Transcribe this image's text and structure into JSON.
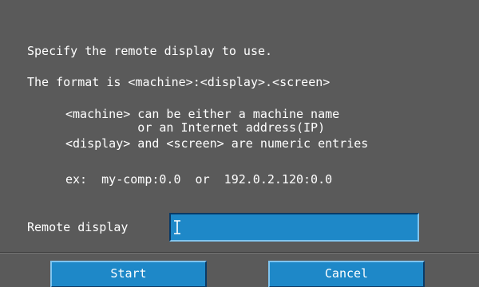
{
  "dialog": {
    "lines": {
      "intro": "Specify the remote display to use.",
      "format": "The format is <machine>:<display>.<screen>",
      "machine_1": "<machine> can be either a machine name",
      "machine_2": "          or an Internet address(IP)",
      "display": "<display> and <screen> are numeric entries",
      "example": "ex:  my-comp:0.0  or  192.0.2.120:0.0"
    },
    "field": {
      "label": "Remote display",
      "value": "",
      "cursor_icon": "text-cursor-icon"
    },
    "buttons": {
      "start": "Start",
      "cancel": "Cancel"
    }
  },
  "colors": {
    "background": "#5a5a5a",
    "text": "#ffffff",
    "field": "#1e88c8",
    "button": "#1e88c8"
  }
}
